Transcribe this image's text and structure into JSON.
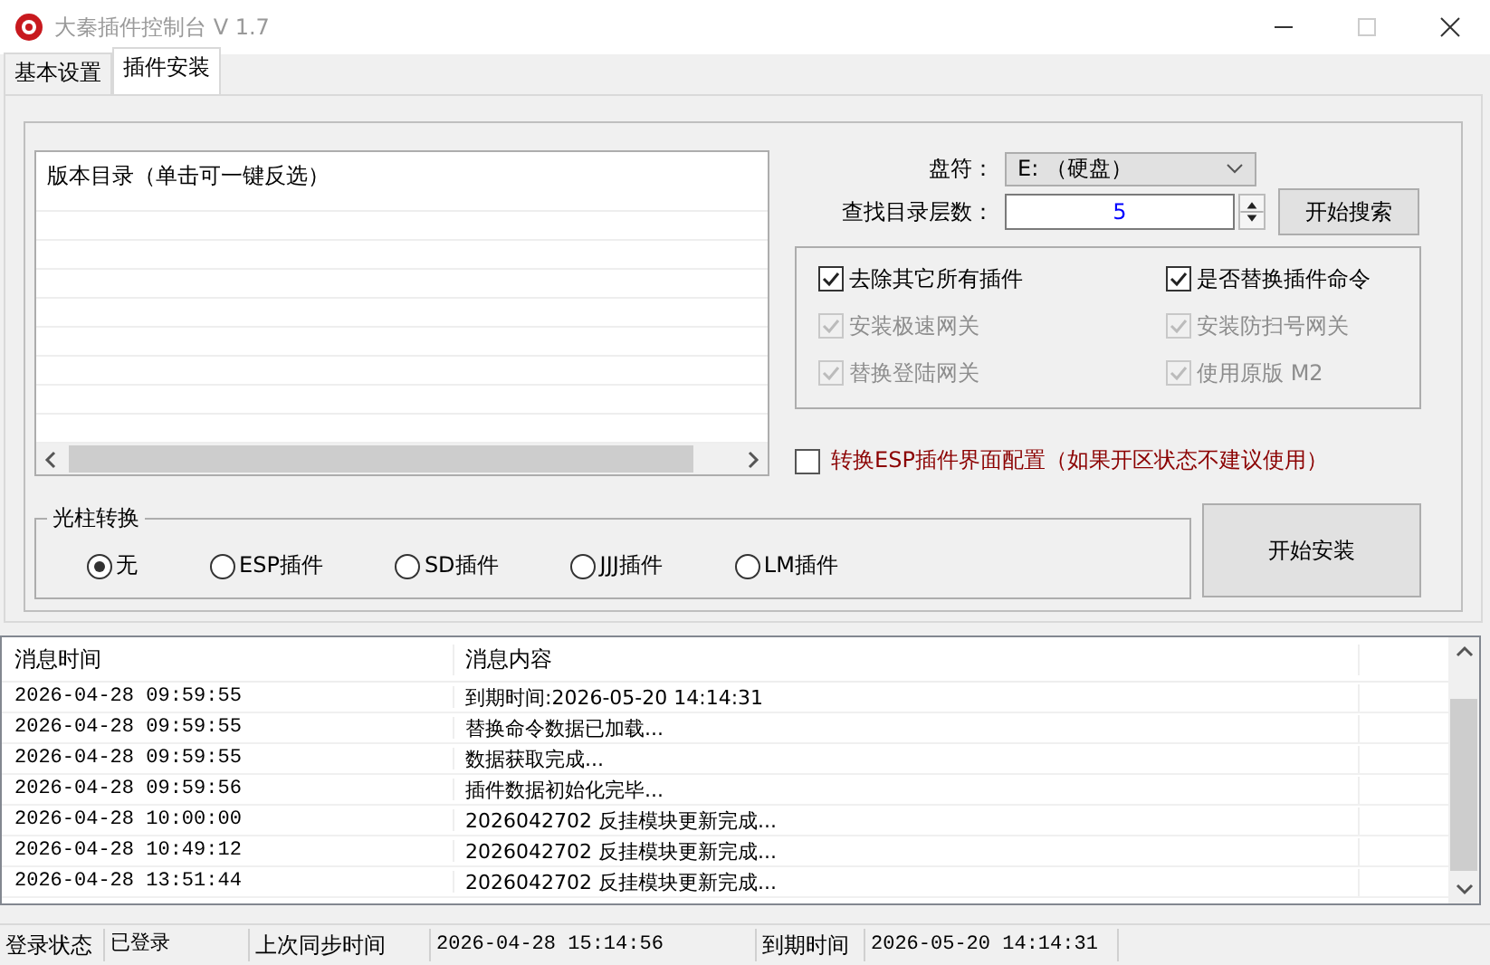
{
  "window": {
    "title": "大秦插件控制台 V 1.7"
  },
  "tabs": [
    {
      "label": "基本设置",
      "selected": false
    },
    {
      "label": "插件安装",
      "selected": true
    }
  ],
  "version_list": {
    "header": "版本目录（单击可一键反选）"
  },
  "drive": {
    "label": "盘符：",
    "value": "E: （硬盘）"
  },
  "depth": {
    "label": "查找目录层数：",
    "value": "5"
  },
  "search_button": "开始搜索",
  "options": [
    {
      "label": "去除其它所有插件",
      "checked": true,
      "disabled": false
    },
    {
      "label": "是否替换插件命令",
      "checked": true,
      "disabled": false
    },
    {
      "label": "安装极速网关",
      "checked": true,
      "disabled": true
    },
    {
      "label": "安装防扫号网关",
      "checked": true,
      "disabled": true
    },
    {
      "label": "替换登陆网关",
      "checked": true,
      "disabled": true
    },
    {
      "label": "使用原版 M2",
      "checked": true,
      "disabled": true
    }
  ],
  "esp_config": {
    "label": "转换ESP插件界面配置（如果开区状态不建议使用）",
    "checked": false
  },
  "light_pillar": {
    "title": "光柱转换",
    "options": [
      {
        "label": "无",
        "selected": true
      },
      {
        "label": "ESP插件",
        "selected": false
      },
      {
        "label": "SD插件",
        "selected": false
      },
      {
        "label": "JJJ插件",
        "selected": false
      },
      {
        "label": "LM插件",
        "selected": false
      }
    ]
  },
  "install_button": "开始安装",
  "log": {
    "columns": [
      "消息时间",
      "消息内容"
    ],
    "rows": [
      {
        "time": "2026-04-28 09:59:55",
        "message": "到期时间:2026-05-20 14:14:31"
      },
      {
        "time": "2026-04-28 09:59:55",
        "message": "替换命令数据已加载..."
      },
      {
        "time": "2026-04-28 09:59:55",
        "message": "数据获取完成..."
      },
      {
        "time": "2026-04-28 09:59:56",
        "message": "插件数据初始化完毕..."
      },
      {
        "time": "2026-04-28 10:00:00",
        "message": "2026042702 反挂模块更新完成..."
      },
      {
        "time": "2026-04-28 10:49:12",
        "message": "2026042702 反挂模块更新完成..."
      },
      {
        "time": "2026-04-28 13:51:44",
        "message": "2026042702 反挂模块更新完成..."
      }
    ]
  },
  "status_bar": [
    {
      "kind": "label",
      "text": "登录状态"
    },
    {
      "kind": "value",
      "text": "已登录"
    },
    {
      "kind": "label",
      "text": "上次同步时间"
    },
    {
      "kind": "value",
      "text": "2026-04-28 15:14:56"
    },
    {
      "kind": "label",
      "text": "到期时间"
    },
    {
      "kind": "value",
      "text": "2026-05-20 14:14:31"
    }
  ]
}
